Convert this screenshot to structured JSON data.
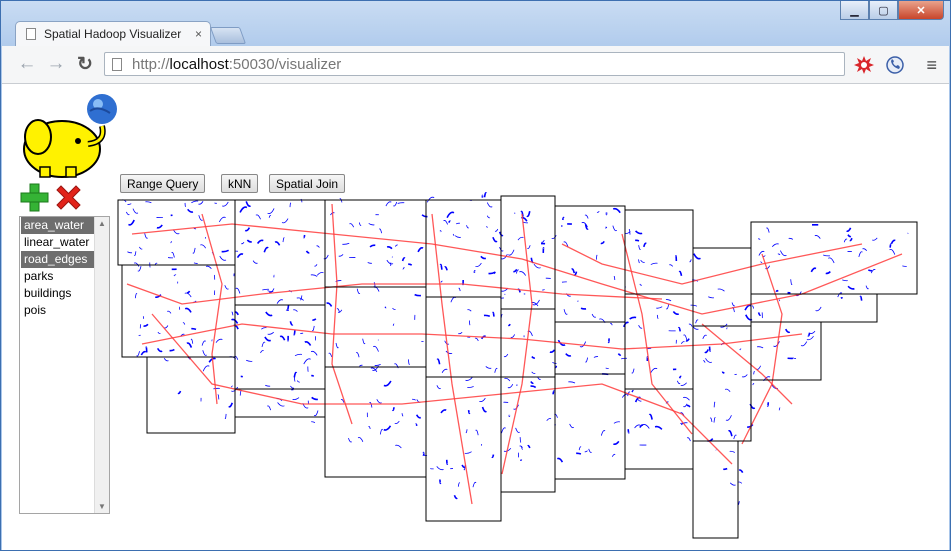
{
  "browser": {
    "tab_title": "Spatial Hadoop Visualizer",
    "tab_close": "×",
    "url_scheme": "http://",
    "url_host": "localhost",
    "url_rest": ":50030/visualizer",
    "back": "←",
    "forward": "→",
    "reload": "↻",
    "menu": "≡"
  },
  "window_controls": {
    "minimize": "▁",
    "maximize": "▢",
    "close": "✕"
  },
  "app": {
    "layers": [
      {
        "label": "area_water",
        "selected": true
      },
      {
        "label": "linear_water",
        "selected": false
      },
      {
        "label": "road_edges",
        "selected": true
      },
      {
        "label": "parks",
        "selected": false
      },
      {
        "label": "buildings",
        "selected": false
      },
      {
        "label": "pois",
        "selected": false
      }
    ],
    "buttons": {
      "range_query": "Range Query",
      "knn": "kNN",
      "spatial_join": "Spatial Join"
    },
    "colors": {
      "water": "#0000ff",
      "roads": "#ff3b3b",
      "partition": "#000000",
      "selected_layer": "#6e6e6e"
    }
  }
}
